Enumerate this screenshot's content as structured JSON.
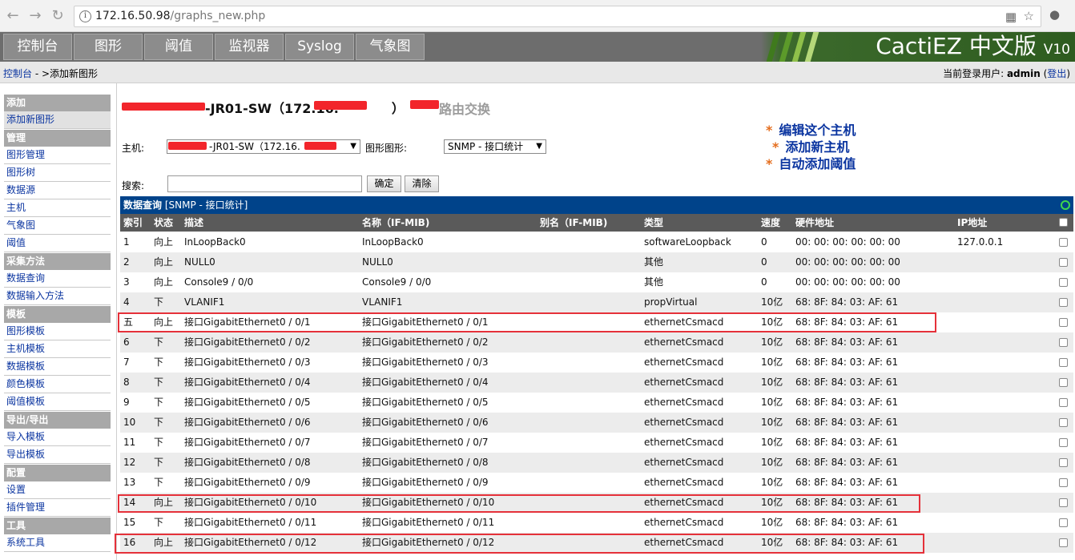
{
  "browser": {
    "url_host": "172.16.50.98",
    "url_path": "/graphs_new.php"
  },
  "nav": {
    "tabs": [
      "控制台",
      "图形",
      "阈值",
      "监视器",
      "Syslog",
      "气象图"
    ],
    "brand": "CactiEZ 中文版",
    "brand_version": "V10"
  },
  "breadcrumb": {
    "root": "控制台",
    "separator": " - >",
    "current": "添加新图形"
  },
  "user": {
    "prefix": "当前登录用户: ",
    "name": "admin",
    "logout": "登出"
  },
  "sidebar": {
    "sections": [
      {
        "title": "添加",
        "items": [
          "添加新图形"
        ]
      },
      {
        "title": "管理",
        "items": [
          "图形管理",
          "图形树",
          "数据源",
          "主机",
          "气象图",
          "阈值"
        ]
      },
      {
        "title": "采集方法",
        "items": [
          "数据查询",
          "数据输入方法"
        ]
      },
      {
        "title": "模板",
        "items": [
          "图形模板",
          "主机模板",
          "数据模板",
          "颜色模板",
          "阈值模板"
        ]
      },
      {
        "title": "导出/导出",
        "items": [
          "导入模板",
          "导出模板"
        ]
      },
      {
        "title": "配置",
        "items": [
          "设置",
          "插件管理"
        ]
      },
      {
        "title": "工具",
        "items": [
          "系统工具"
        ]
      }
    ]
  },
  "host": {
    "title_suffix": "-JR01-SW（172.16.",
    "title_end": "）",
    "desc": "路由交换"
  },
  "actions": [
    "编辑这个主机",
    "添加新主机",
    "自动添加阈值"
  ],
  "form": {
    "host_label": "主机:",
    "host_value": "-JR01-SW（172.16.",
    "graph_type_label": "图形图形:",
    "graph_type_value": "SNMP - 接口统计",
    "search_label": "搜索:",
    "search_value": "",
    "ok_button": "确定",
    "clear_button": "清除"
  },
  "data_query": {
    "title": "数据查询",
    "name": "[SNMP - 接口统计]"
  },
  "table": {
    "columns": [
      "索引",
      "状态",
      "描述",
      "名称（IF-MIB)",
      "别名（IF-MIB)",
      "类型",
      "速度",
      "硬件地址",
      "IP地址"
    ],
    "rows": [
      [
        "1",
        "向上",
        "InLoopBack0",
        "InLoopBack0",
        "",
        "softwareLoopback",
        "0",
        "00: 00: 00: 00: 00: 00",
        "127.0.0.1"
      ],
      [
        "2",
        "向上",
        "NULL0",
        "NULL0",
        "",
        "其他",
        "0",
        "00: 00: 00: 00: 00: 00",
        ""
      ],
      [
        "3",
        "向上",
        "Console9 / 0/0",
        "Console9 / 0/0",
        "",
        "其他",
        "0",
        "00: 00: 00: 00: 00: 00",
        ""
      ],
      [
        "4",
        "下",
        "VLANIF1",
        "VLANIF1",
        "",
        "propVirtual",
        "10亿",
        "68: 8F: 84: 03: AF: 61",
        ""
      ],
      [
        "五",
        "向上",
        "接口GigabitEthernet0 / 0/1",
        "接口GigabitEthernet0 / 0/1",
        "",
        "ethernetCsmacd",
        "10亿",
        "68: 8F: 84: 03: AF: 61",
        ""
      ],
      [
        "6",
        "下",
        "接口GigabitEthernet0 / 0/2",
        "接口GigabitEthernet0 / 0/2",
        "",
        "ethernetCsmacd",
        "10亿",
        "68: 8F: 84: 03: AF: 61",
        ""
      ],
      [
        "7",
        "下",
        "接口GigabitEthernet0 / 0/3",
        "接口GigabitEthernet0 / 0/3",
        "",
        "ethernetCsmacd",
        "10亿",
        "68: 8F: 84: 03: AF: 61",
        ""
      ],
      [
        "8",
        "下",
        "接口GigabitEthernet0 / 0/4",
        "接口GigabitEthernet0 / 0/4",
        "",
        "ethernetCsmacd",
        "10亿",
        "68: 8F: 84: 03: AF: 61",
        ""
      ],
      [
        "9",
        "下",
        "接口GigabitEthernet0 / 0/5",
        "接口GigabitEthernet0 / 0/5",
        "",
        "ethernetCsmacd",
        "10亿",
        "68: 8F: 84: 03: AF: 61",
        ""
      ],
      [
        "10",
        "下",
        "接口GigabitEthernet0 / 0/6",
        "接口GigabitEthernet0 / 0/6",
        "",
        "ethernetCsmacd",
        "10亿",
        "68: 8F: 84: 03: AF: 61",
        ""
      ],
      [
        "11",
        "下",
        "接口GigabitEthernet0 / 0/7",
        "接口GigabitEthernet0 / 0/7",
        "",
        "ethernetCsmacd",
        "10亿",
        "68: 8F: 84: 03: AF: 61",
        ""
      ],
      [
        "12",
        "下",
        "接口GigabitEthernet0 / 0/8",
        "接口GigabitEthernet0 / 0/8",
        "",
        "ethernetCsmacd",
        "10亿",
        "68: 8F: 84: 03: AF: 61",
        ""
      ],
      [
        "13",
        "下",
        "接口GigabitEthernet0 / 0/9",
        "接口GigabitEthernet0 / 0/9",
        "",
        "ethernetCsmacd",
        "10亿",
        "68: 8F: 84: 03: AF: 61",
        ""
      ],
      [
        "14",
        "向上",
        "接口GigabitEthernet0 / 0/10",
        "接口GigabitEthernet0 / 0/10",
        "",
        "ethernetCsmacd",
        "10亿",
        "68: 8F: 84: 03: AF: 61",
        ""
      ],
      [
        "15",
        "下",
        "接口GigabitEthernet0 / 0/11",
        "接口GigabitEthernet0 / 0/11",
        "",
        "ethernetCsmacd",
        "10亿",
        "68: 8F: 84: 03: AF: 61",
        ""
      ],
      [
        "16",
        "向上",
        "接口GigabitEthernet0 / 0/12",
        "接口GigabitEthernet0 / 0/12",
        "",
        "ethernetCsmacd",
        "10亿",
        "68: 8F: 84: 03: AF: 61",
        ""
      ]
    ]
  }
}
